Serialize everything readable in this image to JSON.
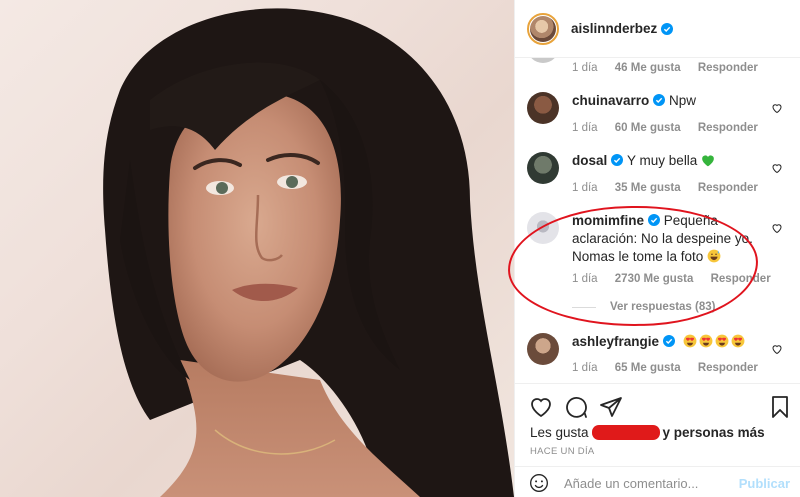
{
  "post": {
    "author": "aislinnderbez",
    "verified": true
  },
  "comments": [
    {
      "username": "",
      "text": "",
      "time": "1 día",
      "likes": "46 Me gusta",
      "reply": "Responder",
      "partial": true
    },
    {
      "username": "chuinavarro",
      "verified": true,
      "text": "Npw",
      "time": "1 día",
      "likes": "60 Me gusta",
      "reply": "Responder"
    },
    {
      "username": "dosal",
      "verified": true,
      "text": "Y muy bella",
      "emoji": "green-heart",
      "time": "1 día",
      "likes": "35 Me gusta",
      "reply": "Responder"
    },
    {
      "username": "momimfine",
      "verified": true,
      "text": "Pequeña aclaración: No la despeine yo. Nomas le tome la foto",
      "emoji": "grinning-sweat",
      "time": "1 día",
      "likes": "2730 Me gusta",
      "reply": "Responder",
      "view_replies": "Ver respuestas (83)",
      "highlighted": true
    },
    {
      "username": "ashleyfrangie",
      "verified": true,
      "text": "",
      "emoji": "heart-eyes x4",
      "time": "1 día",
      "likes": "65 Me gusta",
      "reply": "Responder"
    }
  ],
  "actions": {
    "icons": [
      "heart-icon",
      "comment-icon",
      "share-icon",
      "bookmark-icon"
    ]
  },
  "likes_line": {
    "prefix": "Les gusta",
    "suffix": "y personas más"
  },
  "time_ago": "HACE UN DÍA",
  "add_comment": {
    "placeholder": "Añade un comentario...",
    "publish": "Publicar"
  },
  "colors": {
    "verified": "#0095f6",
    "annotation": "#e0141e",
    "publish_disabled": "#b2dffc"
  }
}
